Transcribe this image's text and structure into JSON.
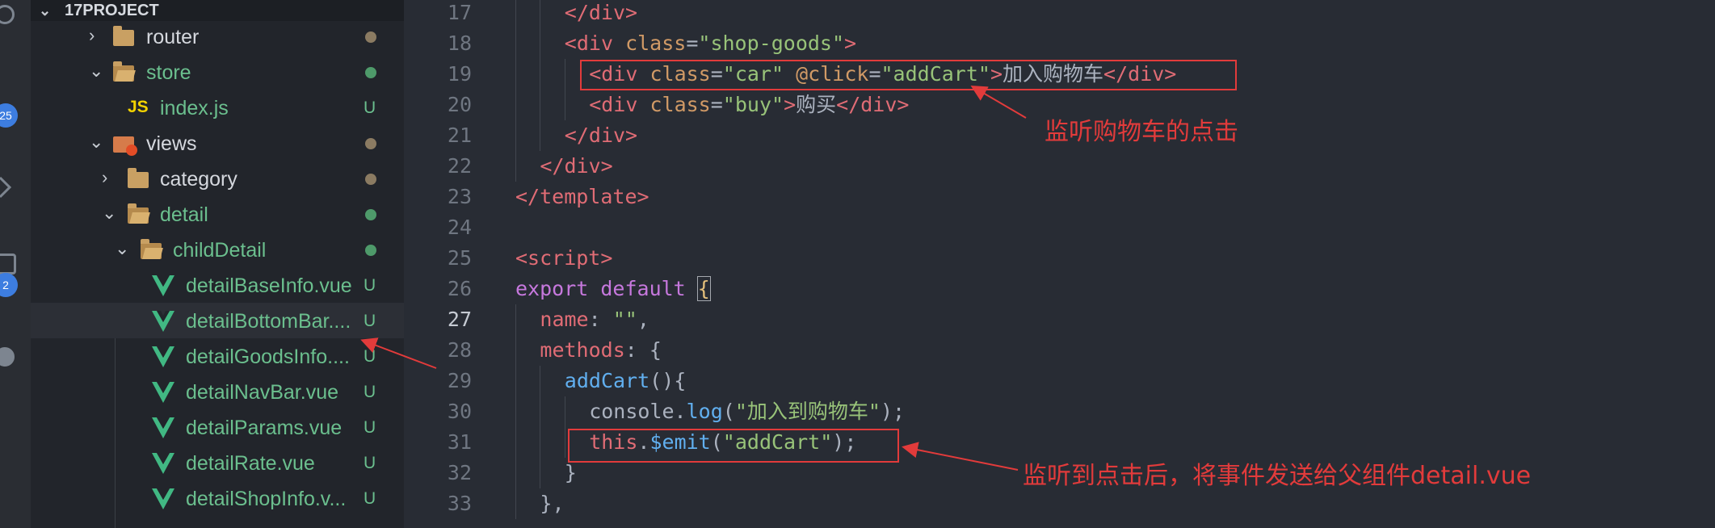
{
  "explorer": {
    "section_title": "17PROJECT",
    "items": [
      {
        "label": "router",
        "status": "",
        "kind": "folder",
        "color": "#d5d8de",
        "dot": "#8b7b62"
      },
      {
        "label": "store",
        "status": "",
        "kind": "folder-open",
        "color": "#6bbf8e",
        "dot": "#4e9a6a"
      },
      {
        "label": "index.js",
        "status": "U",
        "kind": "js",
        "color": "#6bbf8e",
        "dot": ""
      },
      {
        "label": "views",
        "status": "",
        "kind": "views",
        "color": "#d5d8de",
        "dot": "#8b7b62"
      },
      {
        "label": "category",
        "status": "",
        "kind": "folder",
        "color": "#d5d8de",
        "dot": "#8b7b62"
      },
      {
        "label": "detail",
        "status": "",
        "kind": "folder-open",
        "color": "#6bbf8e",
        "dot": "#4e9a6a"
      },
      {
        "label": "childDetail",
        "status": "",
        "kind": "folder-open",
        "color": "#6bbf8e",
        "dot": "#4e9a6a"
      },
      {
        "label": "detailBaseInfo.vue",
        "status": "U",
        "kind": "vue",
        "color": "#6bbf8e"
      },
      {
        "label": "detailBottomBar....",
        "status": "U",
        "kind": "vue",
        "color": "#6bbf8e"
      },
      {
        "label": "detailGoodsInfo....",
        "status": "U",
        "kind": "vue",
        "color": "#6bbf8e"
      },
      {
        "label": "detailNavBar.vue",
        "status": "U",
        "kind": "vue",
        "color": "#6bbf8e"
      },
      {
        "label": "detailParams.vue",
        "status": "U",
        "kind": "vue",
        "color": "#6bbf8e"
      },
      {
        "label": "detailRate.vue",
        "status": "U",
        "kind": "vue",
        "color": "#6bbf8e"
      },
      {
        "label": "detailShopInfo.v...",
        "status": "U",
        "kind": "vue",
        "color": "#6bbf8e"
      }
    ]
  },
  "activity_bar": {
    "badges": [
      "25",
      "2"
    ]
  },
  "editor": {
    "active_line": "27",
    "lines": [
      {
        "n": "17",
        "indent": 2,
        "tokens": [
          [
            "t",
            "</div>"
          ]
        ]
      },
      {
        "n": "18",
        "indent": 2,
        "tokens": [
          [
            "t",
            "<div"
          ],
          [
            "p",
            " "
          ],
          [
            "a",
            "class"
          ],
          [
            "p",
            "="
          ],
          [
            "s",
            "\"shop-goods\""
          ],
          [
            "t",
            ">"
          ]
        ]
      },
      {
        "n": "19",
        "indent": 3,
        "tokens": [
          [
            "t",
            "<div"
          ],
          [
            "p",
            " "
          ],
          [
            "a",
            "class"
          ],
          [
            "p",
            "="
          ],
          [
            "s",
            "\"car\""
          ],
          [
            "p",
            " "
          ],
          [
            "a",
            "@click"
          ],
          [
            "p",
            "="
          ],
          [
            "s",
            "\"addCart\""
          ],
          [
            "t",
            ">"
          ],
          [
            "p",
            "加入购物车"
          ],
          [
            "t",
            "</div>"
          ]
        ]
      },
      {
        "n": "20",
        "indent": 3,
        "tokens": [
          [
            "t",
            "<div"
          ],
          [
            "p",
            " "
          ],
          [
            "a",
            "class"
          ],
          [
            "p",
            "="
          ],
          [
            "s",
            "\"buy\""
          ],
          [
            "t",
            ">"
          ],
          [
            "p",
            "购买"
          ],
          [
            "t",
            "</div>"
          ]
        ]
      },
      {
        "n": "21",
        "indent": 2,
        "tokens": [
          [
            "t",
            "</div>"
          ]
        ]
      },
      {
        "n": "22",
        "indent": 1,
        "tokens": [
          [
            "t",
            "</div>"
          ]
        ]
      },
      {
        "n": "23",
        "indent": 0,
        "tokens": [
          [
            "t",
            "</template>"
          ]
        ]
      },
      {
        "n": "24",
        "indent": 0,
        "tokens": []
      },
      {
        "n": "25",
        "indent": 0,
        "tokens": [
          [
            "t",
            "<script>"
          ]
        ]
      },
      {
        "n": "26",
        "indent": 0,
        "tokens": [
          [
            "k",
            "export"
          ],
          [
            "p",
            " "
          ],
          [
            "k",
            "default"
          ],
          [
            "p",
            " "
          ],
          [
            "br",
            "{"
          ]
        ]
      },
      {
        "n": "27",
        "indent": 1,
        "tokens": [
          [
            "t",
            "name"
          ],
          [
            "p",
            ": "
          ],
          [
            "s",
            "\"\""
          ],
          [
            "p",
            ","
          ]
        ]
      },
      {
        "n": "28",
        "indent": 1,
        "tokens": [
          [
            "t",
            "methods"
          ],
          [
            "p",
            ": {"
          ]
        ]
      },
      {
        "n": "29",
        "indent": 2,
        "tokens": [
          [
            "f",
            "addCart"
          ],
          [
            "p",
            "(){"
          ]
        ]
      },
      {
        "n": "30",
        "indent": 3,
        "tokens": [
          [
            "p",
            "console."
          ],
          [
            "f",
            "log"
          ],
          [
            "p",
            "("
          ],
          [
            "s",
            "\"加入到购物车\""
          ],
          [
            "p",
            ");"
          ]
        ]
      },
      {
        "n": "31",
        "indent": 3,
        "tokens": [
          [
            "t",
            "this"
          ],
          [
            "p",
            "."
          ],
          [
            "f",
            "$emit"
          ],
          [
            "p",
            "("
          ],
          [
            "s",
            "\"addCart\""
          ],
          [
            "p",
            ");"
          ]
        ]
      },
      {
        "n": "32",
        "indent": 2,
        "tokens": [
          [
            "p",
            "}"
          ]
        ]
      },
      {
        "n": "33",
        "indent": 1,
        "tokens": [
          [
            "p",
            "},"
          ]
        ]
      }
    ]
  },
  "annotations": {
    "click_note": "监听购物车的点击",
    "emit_note": "监听到点击后，将事件发送给父组件detail.vue"
  },
  "colors": {
    "annotation_red": "#e23b3b",
    "sidebar_bg": "#22252b",
    "editor_bg": "#282c34",
    "untracked_green": "#6bbf8e"
  }
}
